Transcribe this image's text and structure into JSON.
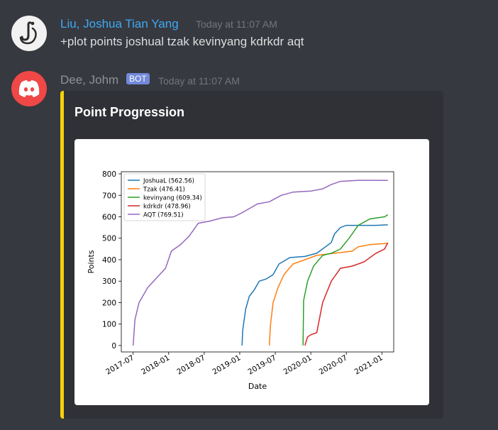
{
  "colors": {
    "background": "#36393f",
    "embed_bg": "#2f3136",
    "embed_accent": "#f6d00b",
    "user1_name": "#3fa9f5",
    "bot_name": "#8e9297",
    "bot_badge": "#7289da"
  },
  "messages": [
    {
      "username": "Liu, Joshua Tian Yang",
      "timestamp": "Today at 11:07 AM",
      "text": "+plot points joshual tzak kevinyang kdrkdr aqt",
      "avatar_icon": "spiral-j-icon"
    },
    {
      "username": "Dee, Johm",
      "badge": "BOT",
      "timestamp": "Today at 11:07 AM",
      "avatar_icon": "discord-logo-icon",
      "embed": {
        "title": "Point Progression"
      }
    }
  ],
  "chart_data": {
    "type": "line",
    "xlabel": "Date",
    "ylabel": "Points",
    "x_ticks": [
      "2017-07",
      "2018-01",
      "2018-07",
      "2019-01",
      "2019-07",
      "2020-01",
      "2020-07",
      "2021-01"
    ],
    "y_ticks": [
      0,
      100,
      200,
      300,
      400,
      500,
      600,
      700,
      800
    ],
    "xlim": [
      "2017-05",
      "2021-03"
    ],
    "ylim": [
      -30,
      810
    ],
    "legend_position": "top-left",
    "series": [
      {
        "name": "JoshuaL (562.56)",
        "color": "#1f77b4",
        "points": [
          [
            "2019-01-13",
            0
          ],
          [
            "2019-01-16",
            70
          ],
          [
            "2019-02-01",
            170
          ],
          [
            "2019-02-20",
            230
          ],
          [
            "2019-03-15",
            260
          ],
          [
            "2019-04-10",
            300
          ],
          [
            "2019-05-15",
            310
          ],
          [
            "2019-06-20",
            330
          ],
          [
            "2019-07-20",
            380
          ],
          [
            "2019-09-15",
            410
          ],
          [
            "2019-12-01",
            415
          ],
          [
            "2020-02-01",
            430
          ],
          [
            "2020-04-15",
            480
          ],
          [
            "2020-05-01",
            520
          ],
          [
            "2020-06-01",
            550
          ],
          [
            "2020-07-01",
            560
          ],
          [
            "2020-12-01",
            560
          ],
          [
            "2021-02-01",
            562.56
          ]
        ]
      },
      {
        "name": "Tzak (476.41)",
        "color": "#ff7f0e",
        "points": [
          [
            "2019-06-01",
            0
          ],
          [
            "2019-06-06",
            90
          ],
          [
            "2019-06-20",
            200
          ],
          [
            "2019-07-15",
            270
          ],
          [
            "2019-08-15",
            330
          ],
          [
            "2019-10-01",
            380
          ],
          [
            "2019-12-01",
            400
          ],
          [
            "2020-02-01",
            420
          ],
          [
            "2020-05-01",
            430
          ],
          [
            "2020-08-01",
            440
          ],
          [
            "2020-09-01",
            460
          ],
          [
            "2020-11-01",
            470
          ],
          [
            "2021-02-01",
            476.41
          ]
        ]
      },
      {
        "name": "kevinyang (609.34)",
        "color": "#2ca02c",
        "points": [
          [
            "2019-11-22",
            0
          ],
          [
            "2019-11-25",
            210
          ],
          [
            "2019-12-15",
            300
          ],
          [
            "2020-01-15",
            370
          ],
          [
            "2020-03-01",
            420
          ],
          [
            "2020-04-15",
            430
          ],
          [
            "2020-06-01",
            450
          ],
          [
            "2020-07-15",
            500
          ],
          [
            "2020-09-01",
            560
          ],
          [
            "2020-11-01",
            590
          ],
          [
            "2021-01-15",
            600
          ],
          [
            "2021-02-01",
            609.34
          ]
        ]
      },
      {
        "name": "kdrkdr (478.96)",
        "color": "#d62728",
        "points": [
          [
            "2019-12-01",
            0
          ],
          [
            "2019-12-15",
            40
          ],
          [
            "2020-01-01",
            50
          ],
          [
            "2020-02-01",
            60
          ],
          [
            "2020-03-01",
            200
          ],
          [
            "2020-04-15",
            300
          ],
          [
            "2020-06-01",
            360
          ],
          [
            "2020-08-01",
            370
          ],
          [
            "2020-10-01",
            390
          ],
          [
            "2020-12-01",
            430
          ],
          [
            "2021-01-15",
            450
          ],
          [
            "2021-02-01",
            478.96
          ]
        ]
      },
      {
        "name": "AQT (769.51)",
        "color": "#9467bd",
        "points": [
          [
            "2017-07-01",
            0
          ],
          [
            "2017-07-10",
            120
          ],
          [
            "2017-08-01",
            200
          ],
          [
            "2017-09-15",
            270
          ],
          [
            "2017-10-15",
            300
          ],
          [
            "2017-12-15",
            360
          ],
          [
            "2018-01-15",
            440
          ],
          [
            "2018-03-01",
            470
          ],
          [
            "2018-04-15",
            510
          ],
          [
            "2018-06-01",
            570
          ],
          [
            "2018-08-01",
            580
          ],
          [
            "2018-10-01",
            595
          ],
          [
            "2018-12-01",
            600
          ],
          [
            "2019-01-15",
            620
          ],
          [
            "2019-04-01",
            660
          ],
          [
            "2019-06-01",
            670
          ],
          [
            "2019-08-01",
            700
          ],
          [
            "2019-10-01",
            715
          ],
          [
            "2020-01-01",
            720
          ],
          [
            "2020-03-01",
            730
          ],
          [
            "2020-04-15",
            750
          ],
          [
            "2020-06-01",
            765
          ],
          [
            "2020-09-01",
            770
          ],
          [
            "2021-02-01",
            769.51
          ]
        ]
      }
    ]
  }
}
